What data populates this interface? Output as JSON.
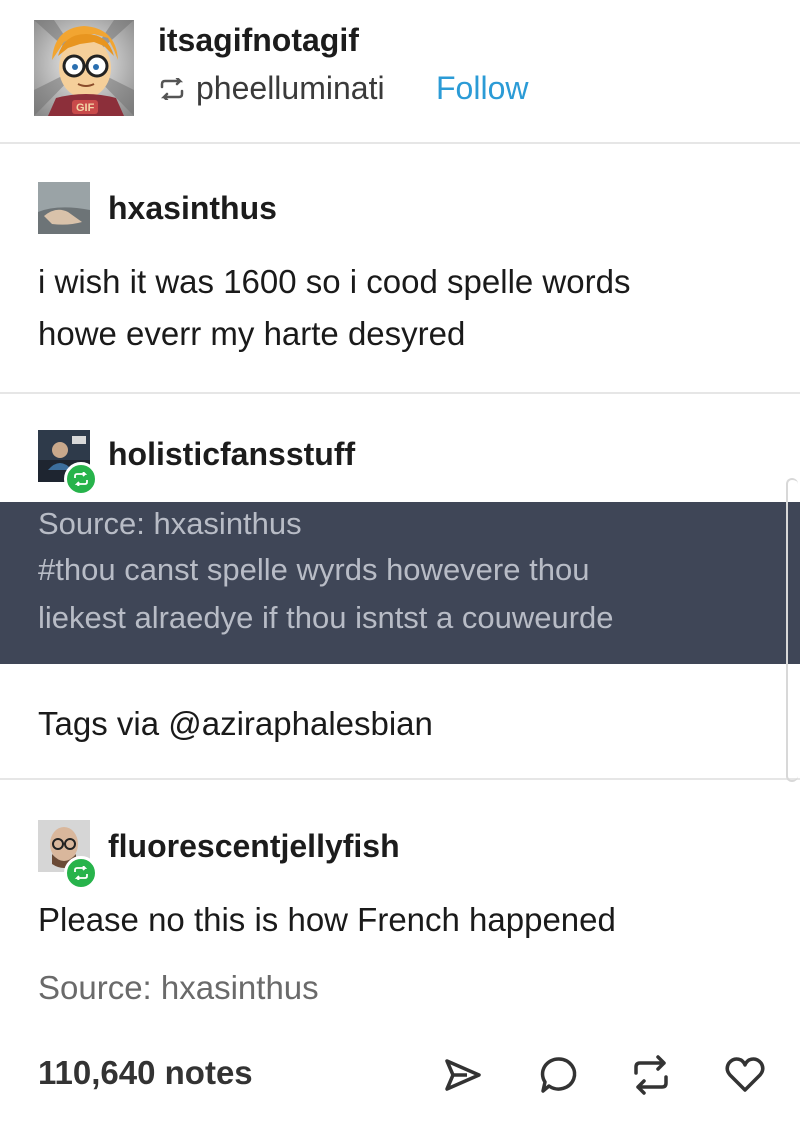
{
  "header": {
    "username": "itsagifnotagif",
    "reblogged_from": "pheelluminati",
    "follow_label": "Follow",
    "avatar_badge_text": "GIF"
  },
  "posts": [
    {
      "username": "hxasinthus",
      "lines": [
        "i wish it was 1600 so i cood spelle words",
        "howe everr my harte desyred"
      ]
    },
    {
      "username": "holisticfansstuff",
      "tags": [
        "Source: hxasinthus",
        "#thou canst spelle wyrds howevere thou",
        "liekest alraedye if thou isntst a couweurde"
      ],
      "text": "Tags via @aziraphalesbian"
    },
    {
      "username": "fluorescentjellyfish",
      "text": "Please no this is how French happened",
      "source": "Source: hxasinthus"
    }
  ],
  "footer": {
    "notes": "110,640 notes"
  },
  "colors": {
    "follow": "#2b9bd6",
    "tag_background": "#3f4657",
    "reblog_badge": "#27b34b"
  }
}
